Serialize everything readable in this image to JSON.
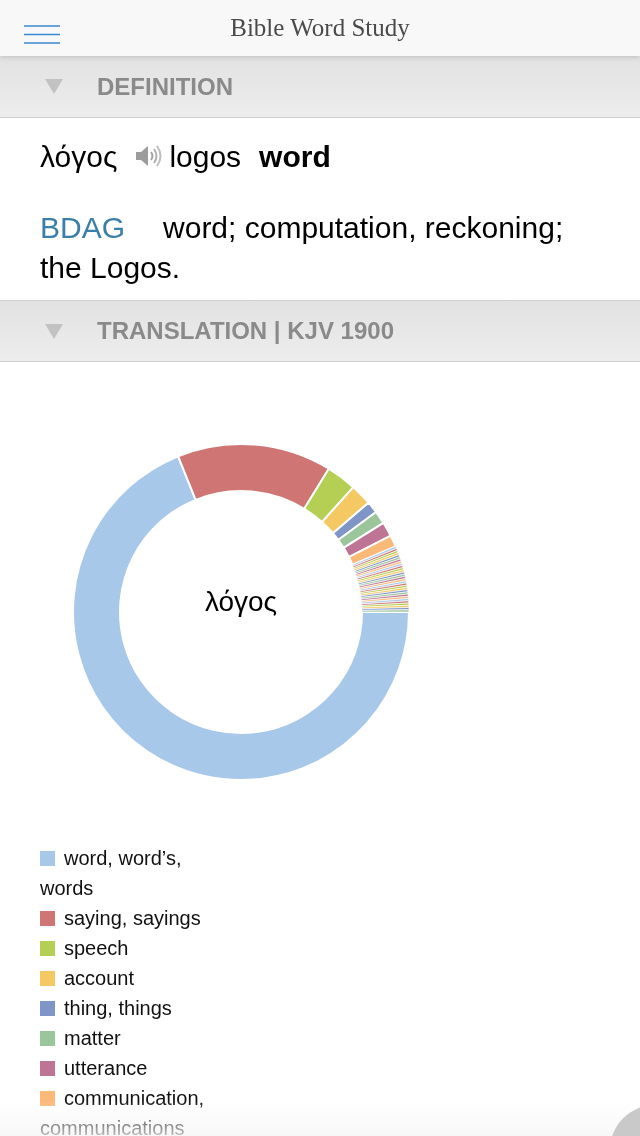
{
  "header": {
    "title": "Bible Word Study"
  },
  "sections": [
    {
      "kind": "definition",
      "title": "DEFINITION",
      "expanded": true,
      "lemma": "λόγος",
      "transliteration": "logos",
      "gloss": "word",
      "source": "BDAG",
      "text": "word; computation, reckoning; the Logos."
    },
    {
      "kind": "translation",
      "title": "TRANSLATION | KJV 1900",
      "expanded": true,
      "chart": {
        "center_label": "λόγος",
        "legend": [
          {
            "label": "word, word’s, words",
            "color": "#a8c8ea"
          },
          {
            "label": "saying, sayings",
            "color": "#cf7675"
          },
          {
            "label": "speech",
            "color": "#b5cf55"
          },
          {
            "label": "account",
            "color": "#f4c862"
          },
          {
            "label": "thing, things",
            "color": "#7f95c6"
          },
          {
            "label": "matter",
            "color": "#9bc59a"
          },
          {
            "label": "utterance",
            "color": "#be7494"
          },
          {
            "label": "communication, communications",
            "color": "#fbb978"
          }
        ]
      }
    }
  ]
}
